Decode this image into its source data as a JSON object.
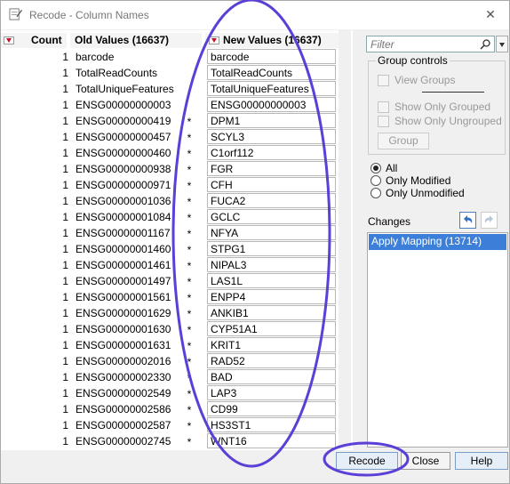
{
  "window": {
    "title": "Recode - Column Names",
    "close_glyph": "✕"
  },
  "table": {
    "headers": {
      "count": "Count",
      "old": "Old Values (16637)",
      "new": "New Values (16637)"
    },
    "rows": [
      {
        "count": "1",
        "old": "barcode",
        "star": "",
        "new": "barcode"
      },
      {
        "count": "1",
        "old": "TotalReadCounts",
        "star": "",
        "new": "TotalReadCounts"
      },
      {
        "count": "1",
        "old": "TotalUniqueFeatures",
        "star": "",
        "new": "TotalUniqueFeatures"
      },
      {
        "count": "1",
        "old": "ENSG00000000003",
        "star": "",
        "new": "ENSG00000000003"
      },
      {
        "count": "1",
        "old": "ENSG00000000419",
        "star": "*",
        "new": "DPM1"
      },
      {
        "count": "1",
        "old": "ENSG00000000457",
        "star": "*",
        "new": "SCYL3"
      },
      {
        "count": "1",
        "old": "ENSG00000000460",
        "star": "*",
        "new": "C1orf112"
      },
      {
        "count": "1",
        "old": "ENSG00000000938",
        "star": "*",
        "new": "FGR"
      },
      {
        "count": "1",
        "old": "ENSG00000000971",
        "star": "*",
        "new": "CFH"
      },
      {
        "count": "1",
        "old": "ENSG00000001036",
        "star": "*",
        "new": "FUCA2"
      },
      {
        "count": "1",
        "old": "ENSG00000001084",
        "star": "*",
        "new": "GCLC"
      },
      {
        "count": "1",
        "old": "ENSG00000001167",
        "star": "*",
        "new": "NFYA"
      },
      {
        "count": "1",
        "old": "ENSG00000001460",
        "star": "*",
        "new": "STPG1"
      },
      {
        "count": "1",
        "old": "ENSG00000001461",
        "star": "*",
        "new": "NIPAL3"
      },
      {
        "count": "1",
        "old": "ENSG00000001497",
        "star": "*",
        "new": "LAS1L"
      },
      {
        "count": "1",
        "old": "ENSG00000001561",
        "star": "*",
        "new": "ENPP4"
      },
      {
        "count": "1",
        "old": "ENSG00000001629",
        "star": "*",
        "new": "ANKIB1"
      },
      {
        "count": "1",
        "old": "ENSG00000001630",
        "star": "*",
        "new": "CYP51A1"
      },
      {
        "count": "1",
        "old": "ENSG00000001631",
        "star": "*",
        "new": "KRIT1"
      },
      {
        "count": "1",
        "old": "ENSG00000002016",
        "star": "*",
        "new": "RAD52"
      },
      {
        "count": "1",
        "old": "ENSG00000002330",
        "star": "*",
        "new": "BAD"
      },
      {
        "count": "1",
        "old": "ENSG00000002549",
        "star": "*",
        "new": "LAP3"
      },
      {
        "count": "1",
        "old": "ENSG00000002586",
        "star": "*",
        "new": "CD99"
      },
      {
        "count": "1",
        "old": "ENSG00000002587",
        "star": "*",
        "new": "HS3ST1"
      },
      {
        "count": "1",
        "old": "ENSG00000002745",
        "star": "*",
        "new": "WNT16"
      }
    ]
  },
  "filter": {
    "placeholder": "Filter"
  },
  "group_controls": {
    "legend": "Group controls",
    "view_groups": "View Groups",
    "show_only_grouped": "Show Only Grouped",
    "show_only_ungrouped": "Show Only Ungrouped",
    "group_button": "Group"
  },
  "view_options": {
    "all": "All",
    "only_modified": "Only Modified",
    "only_unmodified": "Only Unmodified",
    "selected": "All"
  },
  "changes": {
    "label": "Changes",
    "items": [
      "Apply Mapping (13714)"
    ]
  },
  "buttons": {
    "recode": "Recode",
    "close": "Close",
    "help": "Help"
  },
  "colors": {
    "annotation": "#5b3fd6",
    "selection": "#3b7fd8",
    "dropdown_red": "#c8102e"
  }
}
